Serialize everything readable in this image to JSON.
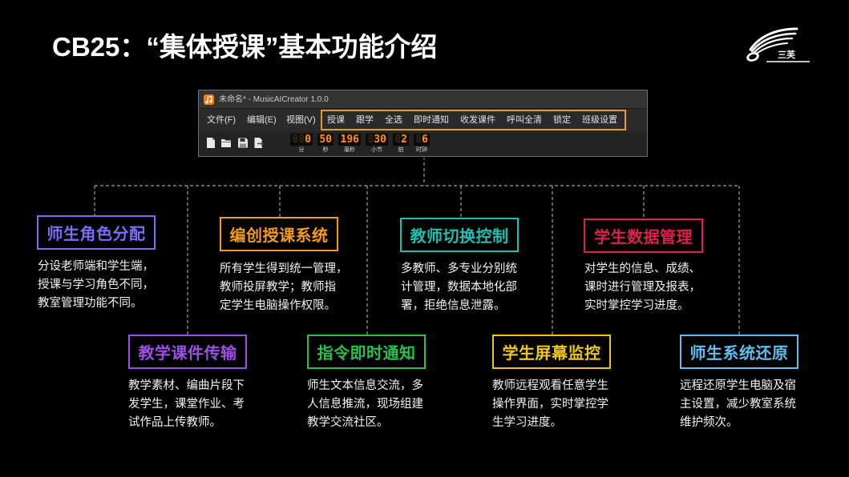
{
  "slide": {
    "title": "CB25：“集体授课”基本功能介绍",
    "logo_text": "三芙",
    "logo_icon": "music-swoosh-logo"
  },
  "app_window": {
    "title": "未命名* - MusicAICreator 1.0.0",
    "app_icon": "music-note-app-icon",
    "menu": [
      "文件(F)",
      "编辑(E)",
      "视图(V)"
    ],
    "highlighted_menu": [
      "授课",
      "跟学",
      "全选",
      "即时通知",
      "收发课件",
      "呼叫全清",
      "锁定",
      "班级设置"
    ],
    "highlight_color": "#e79a2c",
    "toolbar_icons": [
      "new-file-icon",
      "open-folder-icon",
      "save-icon",
      "export-icon"
    ],
    "time_display": [
      {
        "value": "0",
        "label": "分"
      },
      {
        "value": "50",
        "label": "秒"
      },
      {
        "value": "196",
        "label": "毫秒"
      },
      {
        "value": "30",
        "label": "小节"
      },
      {
        "value": "2",
        "label": "拍"
      },
      {
        "value": "6",
        "label": "时钟"
      }
    ],
    "lcd_color": "#ff8c1f"
  },
  "features": [
    {
      "title": "师生角色分配",
      "color": "#7c6cf5",
      "lines": [
        "分设老师端和学生端，",
        "授课与学习角色不同，",
        "教室管理功能不同。"
      ]
    },
    {
      "title": "编创授课系统",
      "color": "#f39a1f",
      "lines": [
        "所有学生得到统一管理，",
        "教师投屏教学；教师指",
        "定学生电脑操作权限。"
      ]
    },
    {
      "title": "教师切换控制",
      "color": "#1fbfb0",
      "lines": [
        "多教师、多专业分别统",
        "计管理，数据本地化部",
        "署，拒绝信息泄露。"
      ]
    },
    {
      "title": "学生数据管理",
      "color": "#e0204a",
      "lines": [
        "对学生的信息、成绩、",
        "课时进行管理及报表，",
        "实时掌控学习进度。"
      ]
    },
    {
      "title": "教学课件传输",
      "color": "#9b4fe8",
      "lines": [
        "教学素材、编曲片段下",
        "发学生，课堂作业、考",
        "试作品上传教师。"
      ]
    },
    {
      "title": "指令即时通知",
      "color": "#2dbd4e",
      "lines": [
        "师生文本信息交流，多",
        "人信息推流，现场组建",
        "教学交流社区。"
      ]
    },
    {
      "title": "学生屏幕监控",
      "color": "#eec51c",
      "lines": [
        "教师远程观看任意学生",
        "操作界面，实时掌控学",
        "生学习进度。"
      ]
    },
    {
      "title": "师生系统还原",
      "color": "#62bdee",
      "lines": [
        "远程还原学生电脑及宿",
        "主设置，减少教室系统",
        "维护频次。"
      ]
    }
  ]
}
